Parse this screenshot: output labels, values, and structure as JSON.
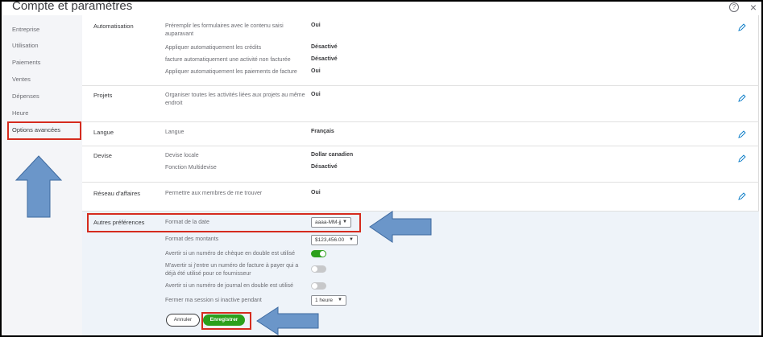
{
  "window": {
    "title": "Compte et paramètres",
    "help_glyph": "?",
    "close_glyph": "×"
  },
  "sidebar": {
    "items": [
      {
        "label": "Entreprise"
      },
      {
        "label": "Utilisation"
      },
      {
        "label": "Paiements"
      },
      {
        "label": "Ventes"
      },
      {
        "label": "Dépenses"
      },
      {
        "label": "Heure"
      },
      {
        "label": "Options avancées"
      }
    ],
    "active_index": 6
  },
  "sections": {
    "automatisation": {
      "title": "Automatisation",
      "rows": [
        {
          "label": "Préremplir les formulaires avec le contenu saisi auparavant",
          "value": "Oui"
        },
        {
          "label": "Appliquer automatiquement les crédits",
          "value": "Désactivé"
        },
        {
          "label": "facture automatiquement une activité non facturée",
          "value": "Désactivé"
        },
        {
          "label": "Appliquer automatiquement les paiements de facture",
          "value": "Oui"
        }
      ]
    },
    "projets": {
      "title": "Projets",
      "rows": [
        {
          "label": "Organiser toutes les activités liées aux projets au même endroit",
          "value": "Oui"
        }
      ]
    },
    "langue": {
      "title": "Langue",
      "rows": [
        {
          "label": "Langue",
          "value": "Français"
        }
      ]
    },
    "devise": {
      "title": "Devise",
      "rows": [
        {
          "label": "Devise locale",
          "value": "Dollar canadien"
        },
        {
          "label": "Fonction Multidevise",
          "value": "Désactivé"
        }
      ]
    },
    "reseau": {
      "title": "Réseau d'affaires",
      "rows": [
        {
          "label": "Permettre aux membres de me trouver",
          "value": "Oui"
        }
      ]
    },
    "autres": {
      "title": "Autres préférences",
      "date_format": {
        "label": "Format de la date",
        "value": "aaaa-MM-jj"
      },
      "amount_format": {
        "label": "Format des montants",
        "value": "$123,456.00"
      },
      "cheque_dup": {
        "label": "Avertir si un numéro de chèque en double est utilisé",
        "on": true
      },
      "invoice_dup": {
        "label": "M'avertir si j'entre un numéro de facture à payer qui a déjà été utilisé pour ce fournisseur",
        "on": false
      },
      "journal_dup": {
        "label": "Avertir si un numéro de journal en double est utilisé",
        "on": false
      },
      "session": {
        "label": "Fermer ma session si inactive pendant",
        "value": "1 heure"
      }
    }
  },
  "footer": {
    "cancel_label": "Annuler",
    "save_label": "Enregistrer"
  },
  "colors": {
    "accent_green": "#2ca01c",
    "highlight_red": "#d52b1e",
    "arrow_blue": "#6b96c9",
    "panel_shade": "#eef3f9"
  },
  "icons": {
    "edit": "pencil-icon",
    "help": "help-icon",
    "close": "close-icon",
    "dropdown": "caret-down-icon"
  }
}
